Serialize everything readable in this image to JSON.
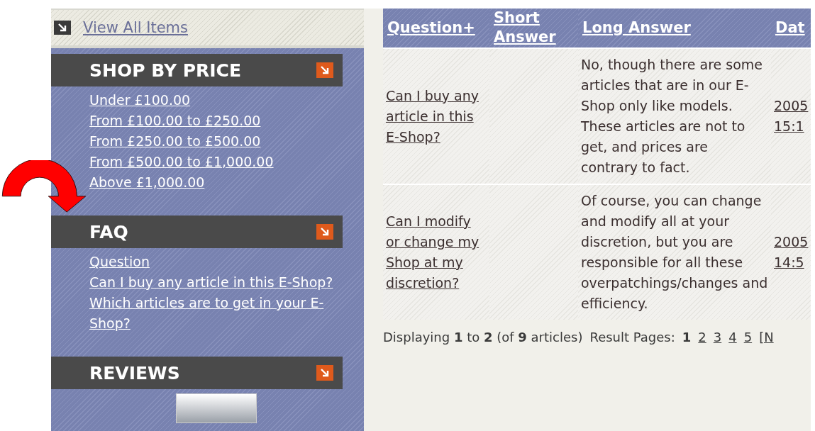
{
  "sidebar": {
    "view_all": "View All Items",
    "sections": [
      {
        "kind": "links",
        "title": "SHOP BY PRICE",
        "links": [
          "Under £100.00",
          "From £100.00 to £250.00",
          "From £250.00 to £500.00",
          "From £500.00 to £1,000.00",
          "Above £1,000.00"
        ]
      },
      {
        "kind": "links",
        "title": "FAQ",
        "links": [
          "Question",
          "Can I buy any article in this E-Shop?",
          "Which articles are to get in your E-Shop?"
        ]
      },
      {
        "kind": "image",
        "title": "REVIEWS"
      }
    ]
  },
  "table": {
    "columns": [
      "Question+",
      "Short Answer",
      "Long Answer",
      "Dat"
    ],
    "rows": [
      {
        "question": "Can I buy any article in this E-Shop?",
        "long_answer": "No, though there are some articles that are in our E-Shop only like models. These articles are not to get, and prices are contrary to fact.",
        "date": "2005",
        "time": "15:1"
      },
      {
        "question": "Can I modify or change my Shop at my discretion?",
        "long_answer": "Of course, you can change and modify all at your discretion, but you are responsible for all these overpatchings/changes and efficiency.",
        "date": "2005",
        "time": "14:5"
      }
    ]
  },
  "pagination": {
    "summary": "Displaying **1** to **2** (of **9** articles)",
    "label": "Result Pages:",
    "pages": [
      {
        "label": "1",
        "selected": true
      },
      {
        "label": "2",
        "selected": false
      },
      {
        "label": "3",
        "selected": false
      },
      {
        "label": "4",
        "selected": false
      },
      {
        "label": "5",
        "selected": false
      },
      {
        "label": "[N",
        "selected": false
      }
    ]
  }
}
